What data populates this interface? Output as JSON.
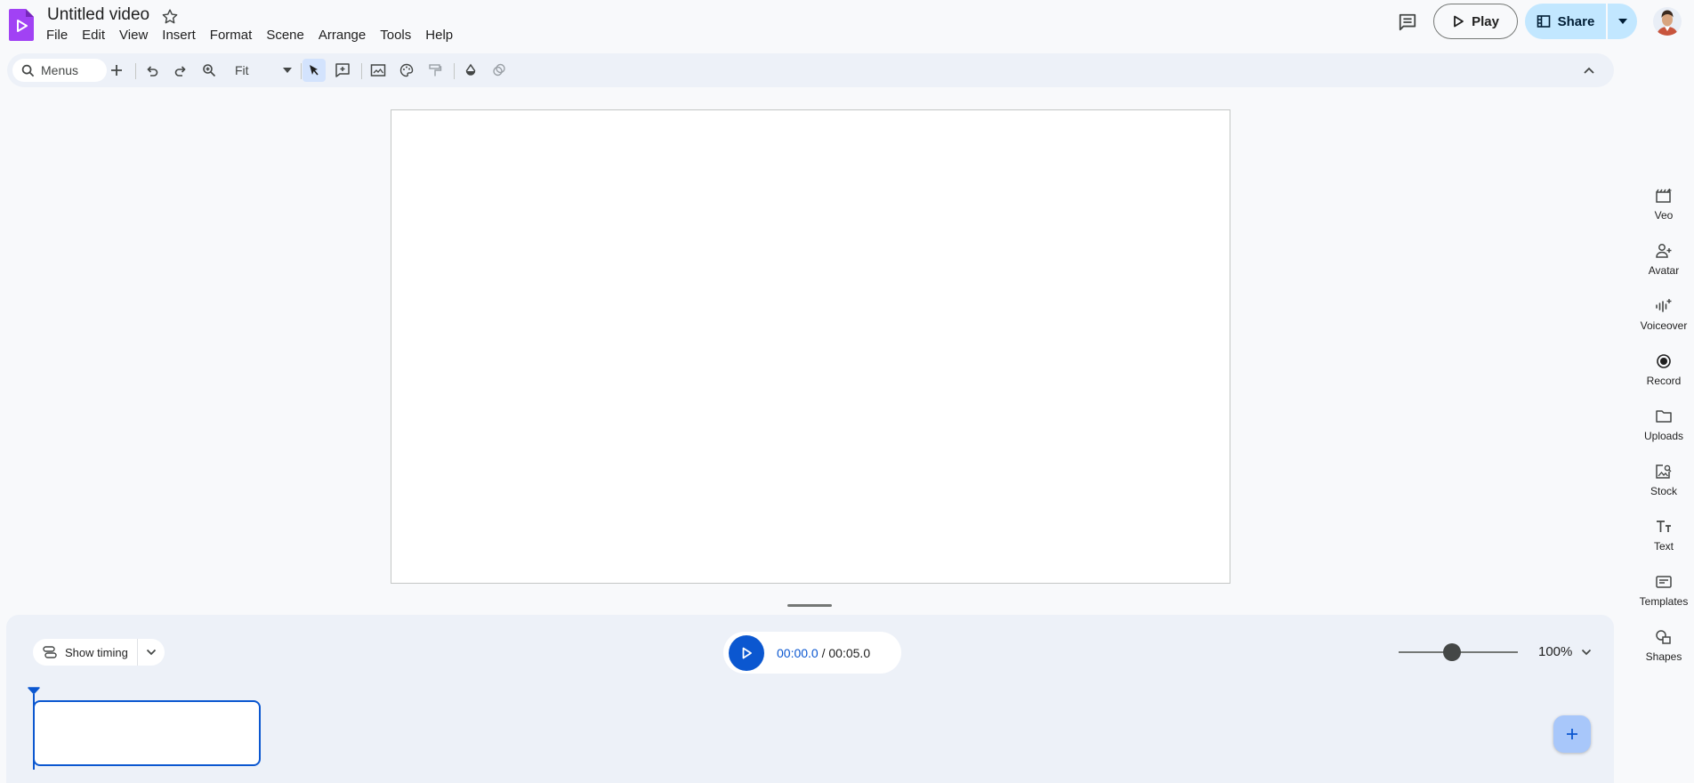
{
  "app": {
    "doc_title": "Untitled video",
    "menus": [
      "File",
      "Edit",
      "View",
      "Insert",
      "Format",
      "Scene",
      "Arrange",
      "Tools",
      "Help"
    ],
    "play_label": "Play",
    "share_label": "Share",
    "brand_color": "#a142f4",
    "accent_color": "#0b57d0"
  },
  "toolbar": {
    "search_placeholder": "Menus",
    "zoom_label": "Fit",
    "icons": [
      "add-icon",
      "undo-icon",
      "redo-icon",
      "zoom-icon",
      "select-icon",
      "textbox-icon",
      "image-icon",
      "palette-icon",
      "paint-format-icon",
      "fill-color-icon",
      "effects-icon",
      "collapse-icon"
    ]
  },
  "side_panel": {
    "items": [
      {
        "label": "Veo",
        "icon": "veo-icon"
      },
      {
        "label": "Avatar",
        "icon": "avatar-icon"
      },
      {
        "label": "Voiceover",
        "icon": "voiceover-icon"
      },
      {
        "label": "Record",
        "icon": "record-icon"
      },
      {
        "label": "Uploads",
        "icon": "folder-icon"
      },
      {
        "label": "Stock",
        "icon": "stock-icon"
      },
      {
        "label": "Text",
        "icon": "text-icon"
      },
      {
        "label": "Templates",
        "icon": "templates-icon"
      },
      {
        "label": "Shapes",
        "icon": "shapes-icon"
      }
    ]
  },
  "timeline": {
    "show_timing_label": "Show timing",
    "current_time": "00:00.0",
    "separator": " / ",
    "total_time": "00:05.0",
    "zoom_value": "100%",
    "zoom_level": 0.45
  }
}
